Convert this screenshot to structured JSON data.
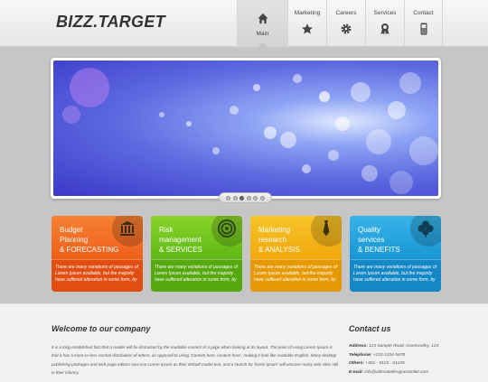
{
  "header": {
    "logo": "BIZZ.TARGET"
  },
  "nav": [
    {
      "label": "Main",
      "icon": "home-icon",
      "active": true
    },
    {
      "label": "Marketing",
      "icon": "star-icon"
    },
    {
      "label": "Careers",
      "icon": "gear-icon"
    },
    {
      "label": "Services",
      "icon": "award-icon"
    },
    {
      "label": "Contact",
      "icon": "phone-icon"
    }
  ],
  "slider": {
    "slide_count": 6,
    "active_slide": 3
  },
  "features": [
    {
      "title": [
        "Budget",
        "Planning",
        "& FORECASTING"
      ],
      "icon": "bank-icon",
      "color": "#f26822",
      "text": "There are many variations of passages of Lorem Ipsum available, but the majority have suffered alteration in some form, by"
    },
    {
      "title": [
        "Risk",
        "management",
        "& SERVICES"
      ],
      "icon": "target-icon",
      "color": "#6cc21c",
      "text": "There are many variations of passages of Lorem Ipsum available, but the majority have suffered alteration in some form, by"
    },
    {
      "title": [
        "Marketing",
        "research",
        "& ANALYSIS"
      ],
      "icon": "tie-icon",
      "color": "#f1b112",
      "text": "There are many variations of passages of Lorem Ipsum available, but the majority have suffered alteration in some form, by"
    },
    {
      "title": [
        "Quality",
        "services",
        "& BENEFITS"
      ],
      "icon": "clover-icon",
      "color": "#1c9ed9",
      "text": "There are many variations of passages of Lorem Ipsum available, but the majority have suffered alteration in some form, by"
    }
  ],
  "welcome": {
    "title": "Welcome to our company",
    "body": "It is a long established fact that a reader will be distracted by the readable content of a page when looking at its layout. The point of using Lorem Ipsum is that it has a more-or-less normal distribution of letters, as opposed to using 'Content here, content here', making it look like readable English. Many desktop publishing packages and web page editors now use Lorem Ipsum as their default model text, and a search for 'lorem ipsum' will uncover many web sites still in their infancy."
  },
  "contact": {
    "title": "Contact us",
    "address_label": "Address:",
    "address": "123 Sample Road, Greenvalley, 123",
    "telephone_label": "Telephone:",
    "telephone": "+123-1234-5678",
    "others_label": "Others:",
    "others": "+301 - 0123 - 01235",
    "email_label": "E-mail:",
    "email": "info@ultimatedesignertoolkit.com"
  }
}
